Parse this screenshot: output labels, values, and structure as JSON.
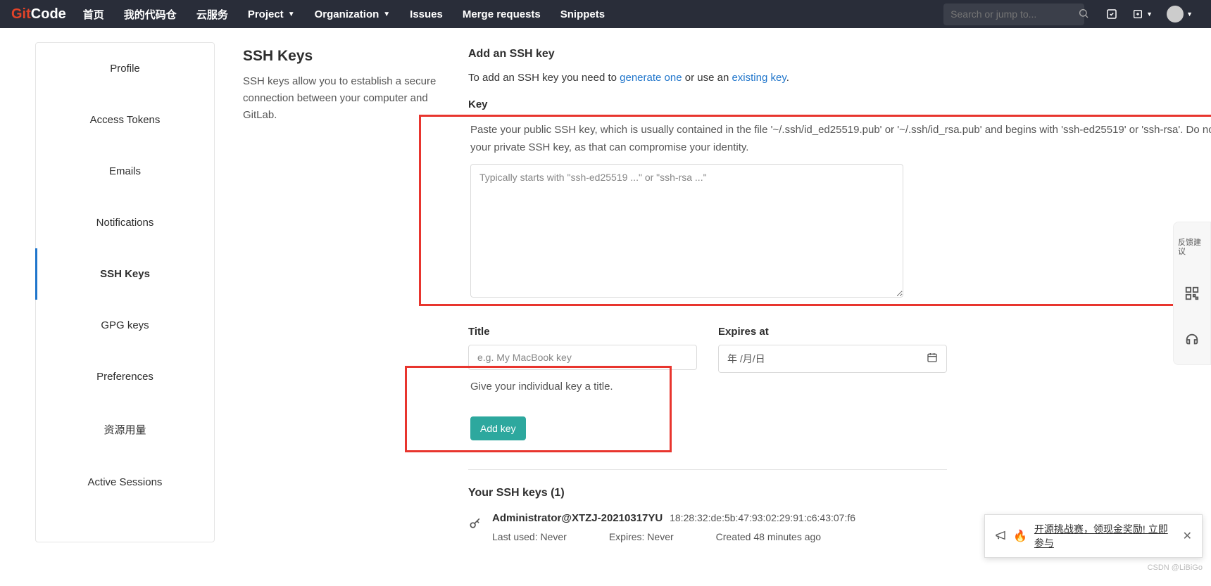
{
  "nav": {
    "logo_git": "Git",
    "logo_code": "Code",
    "home": "首页",
    "myrepo": "我的代码仓",
    "cloud": "云服务",
    "project": "Project",
    "organization": "Organization",
    "issues": "Issues",
    "merge_requests": "Merge requests",
    "snippets": "Snippets",
    "search_placeholder": "Search or jump to..."
  },
  "sidebar": {
    "items": [
      {
        "label": "Profile"
      },
      {
        "label": "Access Tokens"
      },
      {
        "label": "Emails"
      },
      {
        "label": "Notifications"
      },
      {
        "label": "SSH Keys"
      },
      {
        "label": "GPG keys"
      },
      {
        "label": "Preferences"
      },
      {
        "label": "资源用量"
      },
      {
        "label": "Active Sessions"
      }
    ]
  },
  "intro": {
    "title": "SSH Keys",
    "desc": "SSH keys allow you to establish a secure connection between your computer and GitLab."
  },
  "form": {
    "add_heading": "Add an SSH key",
    "add_help_1": "To add an SSH key you need to ",
    "add_help_link1": "generate one",
    "add_help_2": " or use an ",
    "add_help_link2": "existing key",
    "add_help_3": ".",
    "key_label": "Key",
    "key_hint": "Paste your public SSH key, which is usually contained in the file '~/.ssh/id_ed25519.pub' or '~/.ssh/id_rsa.pub' and begins with 'ssh-ed25519' or 'ssh-rsa'. Do not paste your private SSH key, as that can compromise your identity.",
    "key_placeholder": "Typically starts with \"ssh-ed25519 ...\" or \"ssh-rsa ...\"",
    "title_label": "Title",
    "title_placeholder": "e.g. My MacBook key",
    "title_hint": "Give your individual key a title.",
    "expires_label": "Expires at",
    "expires_placeholder": "年 /月/日",
    "add_btn": "Add key"
  },
  "keys": {
    "heading": "Your SSH keys (1)",
    "items": [
      {
        "title": "Administrator@XTZJ-20210317YU",
        "fingerprint": "18:28:32:de:5b:47:93:02:29:91:c6:43:07:f6",
        "last_used": "Last used: Never",
        "expires": "Expires: Never",
        "created": "Created 48 minutes ago"
      }
    ]
  },
  "rail": {
    "feedback": "反馈建议"
  },
  "notif": {
    "prefix": "开源挑战赛，领现金奖励! ",
    "suffix": "立即参与"
  },
  "watermark": "CSDN @LiBiGo"
}
